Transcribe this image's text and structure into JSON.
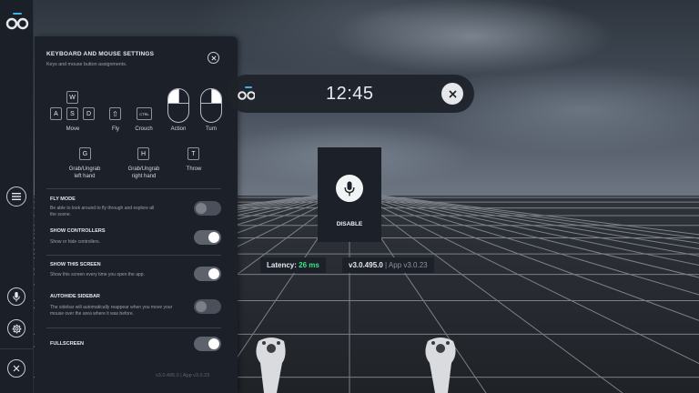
{
  "settings_panel": {
    "title": "KEYBOARD AND MOUSE SETTINGS",
    "subtitle": "Keys and mouse button assignments.",
    "keys": {
      "w": "W",
      "a": "A",
      "s": "S",
      "d": "D",
      "fly_key": "⇧",
      "crouch_key": "CTRL",
      "g": "G",
      "h": "H",
      "t": "T"
    },
    "labels": {
      "move": "Move",
      "fly": "Fly",
      "crouch": "Crouch",
      "action": "Action",
      "turn": "Turn",
      "grab_left": "Grab/Ungrab\nleft hand",
      "grab_right": "Grab/Ungrab\nright hand",
      "throw": "Throw"
    },
    "options": [
      {
        "title": "FLY MODE",
        "desc": "Be able to look around to fly through and explore all the scene.",
        "enabled": false
      },
      {
        "title": "SHOW CONTROLLERS",
        "desc": "Show or hide controllers.",
        "enabled": true
      },
      {
        "title": "SHOW THIS SCREEN",
        "desc": "Show this screen every time you open the app.",
        "enabled": true
      },
      {
        "title": "AUTOHIDE SIDEBAR",
        "desc": "The sidebar will automatically reappear when you move your mouse over the area where it was before.",
        "enabled": false
      },
      {
        "title": "FULLSCREEN",
        "desc": "",
        "enabled": true
      }
    ],
    "version": "v3.0.495.0 | App v3.0.23"
  },
  "topbar": {
    "time": "12:45"
  },
  "mic_card": {
    "label": "DISABLE"
  },
  "status": {
    "latency_label": "Latency:",
    "latency_value": "26 ms",
    "version": "v3.0.495.0",
    "app_version": "| App v3.0.23"
  },
  "colors": {
    "accent": "#3fb2e8",
    "latency_green": "#3fe48a",
    "panel_bg": "#1c2028"
  }
}
